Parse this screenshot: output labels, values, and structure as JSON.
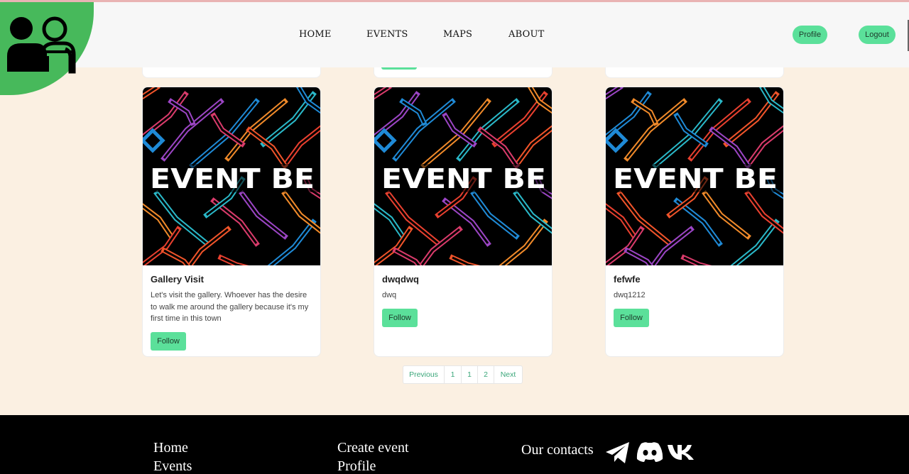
{
  "nav": {
    "links": [
      "HOME",
      "EVENTS",
      "MAPS",
      "ABOUT"
    ],
    "profile_label": "Profile",
    "logout_label": "Logout"
  },
  "cards": [
    {
      "title": "Gallery Visit",
      "description": "Let's visit the gallery. Whoever has the desire to walk me around the gallery because it's my first time in this town",
      "follow_label": "Follow",
      "image_text": "EVENT BE"
    },
    {
      "title": "dwqdwq",
      "description": "dwq",
      "follow_label": "Follow",
      "image_text": "EVENT BE"
    },
    {
      "title": "fefwfe",
      "description": "dwq1212",
      "follow_label": "Follow",
      "image_text": "EVENT BE"
    }
  ],
  "pagination": {
    "previous": "Previous",
    "pages": [
      "1",
      "1",
      "2"
    ],
    "next": "Next"
  },
  "footer": {
    "col1": [
      "Home",
      "Events"
    ],
    "col2": [
      "Create event",
      "Profile"
    ],
    "contacts_label": "Our contacts",
    "social_icons": [
      "telegram-icon",
      "discord-icon",
      "vk-icon"
    ]
  },
  "colors": {
    "accent": "#5be09a",
    "logo_green": "#47b95b",
    "page_bg": "#fbf0e2",
    "navbar_bg": "#f7f7f7",
    "footer_bg": "#000000"
  }
}
